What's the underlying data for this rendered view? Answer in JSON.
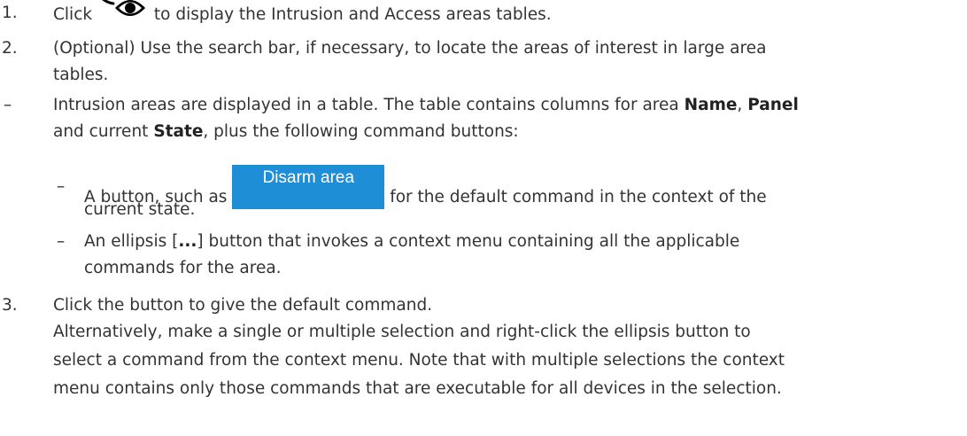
{
  "steps": [
    {
      "number": "1.",
      "before_icon": "Click",
      "icon": "eye-icon",
      "after_icon": "to display the Intrusion and Access areas tables."
    },
    {
      "number": "2.",
      "line1": "(Optional) Use the search bar, if necessary, to locate the areas of interest in large area",
      "line2": "tables."
    }
  ],
  "bullet": {
    "dash": "–",
    "line1_a": "Intrusion areas are displayed in a table. The table contains columns for area",
    "name": "Name",
    "comma": ",",
    "panel": "Panel",
    "line2_a": "and current",
    "state": "State",
    "line2_b": ", plus the following command buttons:"
  },
  "sub_bullets": [
    {
      "dash": "–",
      "before_button": "A button, such as",
      "button_label": "Disarm area",
      "after_button": "for the default command in the context of the",
      "line2": "current state."
    },
    {
      "dash": "–",
      "line1_a": "An ellipsis [",
      "ellipsis": "...",
      "line1_b": "] button that invokes a context menu containing all the applicable",
      "line2": "commands for the area."
    }
  ],
  "step3": {
    "number": "3.",
    "line1": "Click the button to give the default command.",
    "line2": "Alternatively, make a single or multiple selection and right-click the ellipsis button to",
    "line3": "select a command from the context menu. Note that with multiple selections the context",
    "line4": "menu contains only those commands that are executable for all devices in the selection."
  },
  "colors": {
    "text": "#333333",
    "button_bg": "#1e8fd6",
    "button_text": "#ffffff"
  }
}
